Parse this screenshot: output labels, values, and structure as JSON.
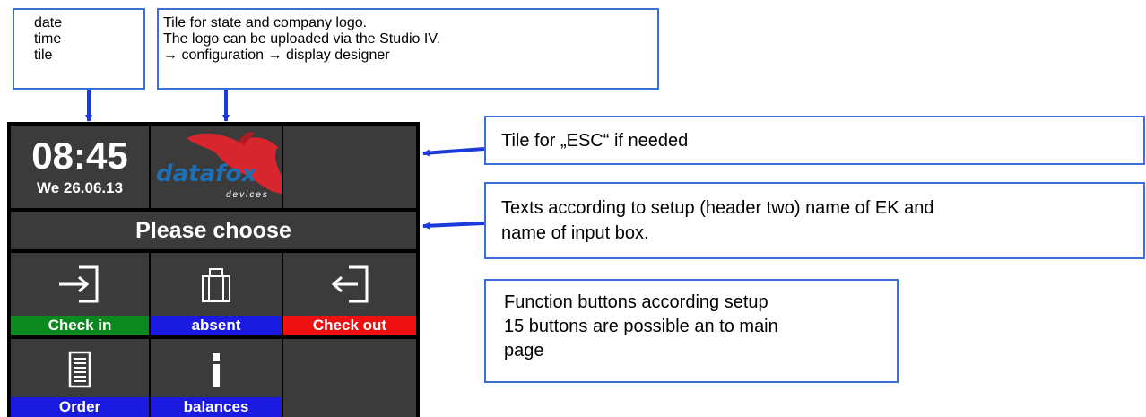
{
  "callouts": {
    "date": {
      "lines": [
        "date",
        "time",
        "tile"
      ]
    },
    "logo": {
      "lines": [
        "Tile for state and company logo.",
        "The logo can be uploaded via the Studio IV.",
        "→ configuration → display designer"
      ]
    },
    "esc": {
      "lines": [
        "Tile for „ESC“ if needed"
      ]
    },
    "texts": {
      "lines": [
        "Texts according to setup (header two) name of EK and",
        "name of input box."
      ]
    },
    "func": {
      "lines": [
        "Function buttons according setup",
        "15 buttons are possible an to main",
        "page"
      ]
    }
  },
  "screen": {
    "time": "08:45",
    "date": "We 26.06.13",
    "logo": {
      "word": "datafox",
      "sub": "devices"
    },
    "header": "Please choose",
    "buttons": [
      {
        "label": "Check in",
        "color": "#0a8a1e",
        "icon": "check-in-icon"
      },
      {
        "label": "absent",
        "color": "#1a1ae0",
        "icon": "briefcase-icon"
      },
      {
        "label": "Check out",
        "color": "#ee1111",
        "icon": "check-out-icon"
      },
      {
        "label": "Order",
        "color": "#1a1ae0",
        "icon": "document-icon"
      },
      {
        "label": "balances",
        "color": "#1a1ae0",
        "icon": "info-icon"
      }
    ]
  },
  "colors": {
    "callout_border": "#3a6fd8",
    "arrow": "#1a3adb",
    "tile": "#3b3b3b",
    "screen_bg": "#000000",
    "logo_red": "#d8262e",
    "logo_blue": "#1f6fb5"
  }
}
